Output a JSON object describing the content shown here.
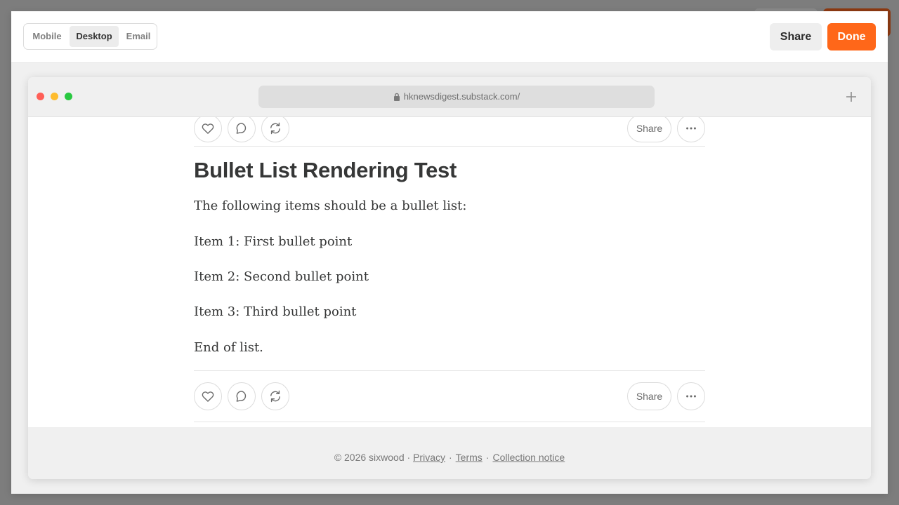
{
  "editor": {
    "preview_modes": [
      "Mobile",
      "Desktop",
      "Email"
    ],
    "selected_mode": "Desktop",
    "share_label": "Share",
    "done_label": "Done",
    "accent_color": "#ff6719"
  },
  "browser": {
    "url": "hknewsdigest.substack.com/"
  },
  "post": {
    "title": "Bullet List Rendering Test",
    "intro": "The following items should be a bullet list:",
    "items": [
      "Item 1: First bullet point",
      "Item 2: Second bullet point",
      "Item 3: Third bullet point"
    ],
    "outro": "End of list.",
    "share_label": "Share"
  },
  "footer": {
    "copyright": "© 2026 sixwood ·",
    "privacy": "Privacy",
    "terms": "Terms",
    "collection_notice": "Collection notice"
  }
}
